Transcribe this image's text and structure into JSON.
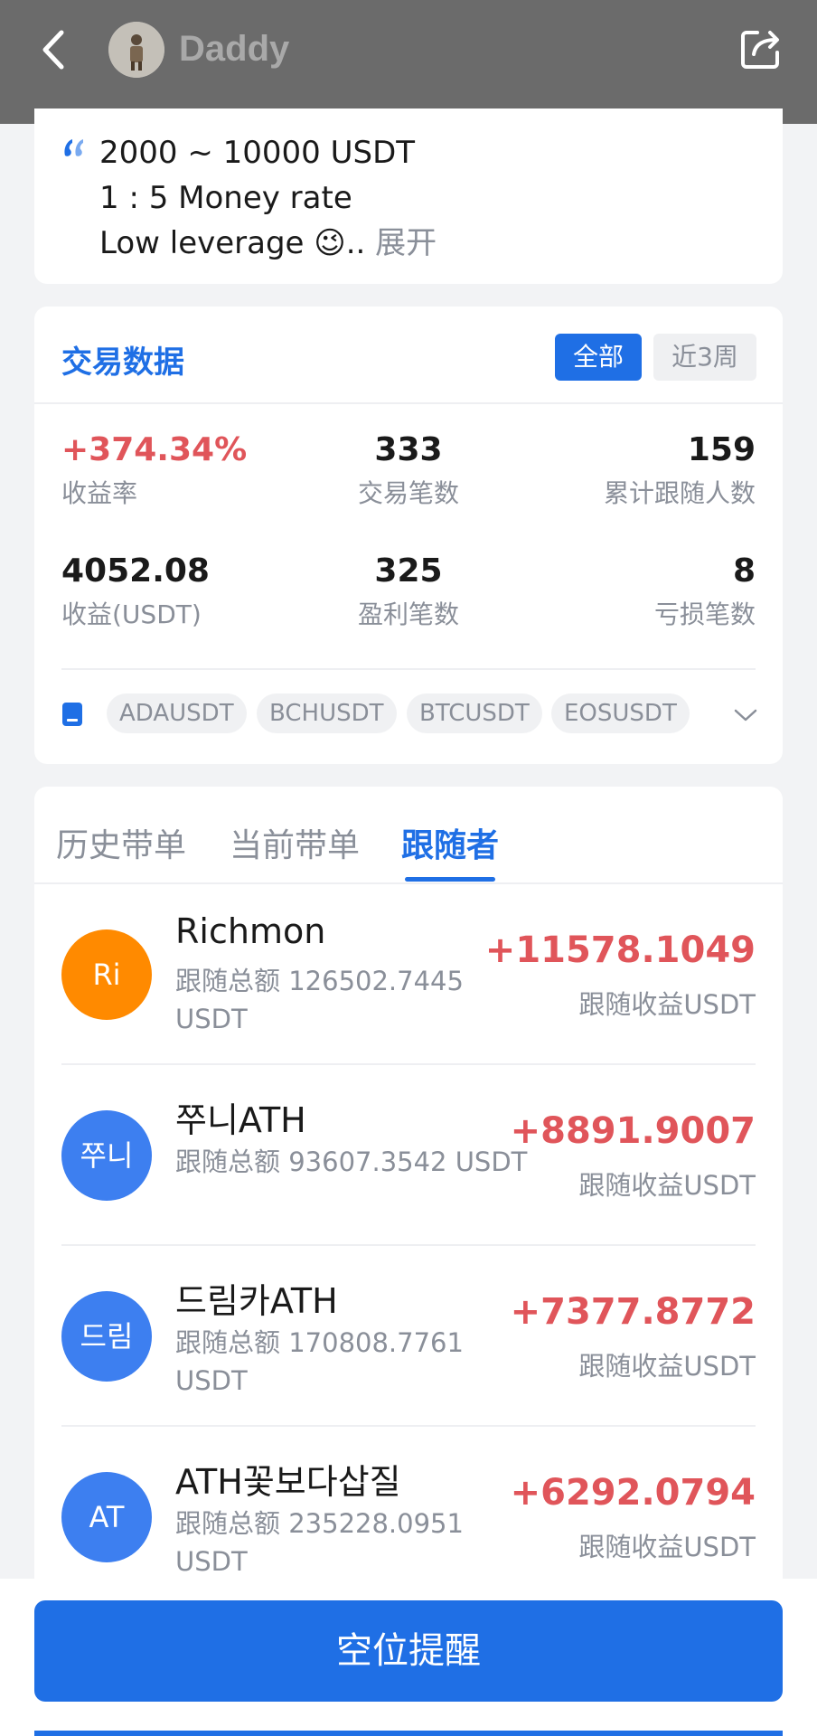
{
  "header": {
    "title": "Daddy"
  },
  "description": {
    "line1": "2000 ~ 10000 USDT",
    "line2": "1 : 5 Money rate",
    "line3": "Low leverage 😉..",
    "expand": "展开"
  },
  "trade": {
    "title": "交易数据",
    "tab_all": "全部",
    "tab_3w": "近3周",
    "stats": {
      "yield": {
        "value": "+374.34%",
        "label": "收益率"
      },
      "trades": {
        "value": "333",
        "label": "交易笔数"
      },
      "followers_total": {
        "value": "159",
        "label": "累计跟随人数"
      },
      "profit": {
        "value": "4052.08",
        "label": "收益(USDT)"
      },
      "win_trades": {
        "value": "325",
        "label": "盈利笔数"
      },
      "loss_trades": {
        "value": "8",
        "label": "亏损笔数"
      }
    },
    "pairs": [
      "ADAUSDT",
      "BCHUSDT",
      "BTCUSDT",
      "EOSUSDT"
    ]
  },
  "tabs": {
    "history": "历史带单",
    "current": "当前带单",
    "followers": "跟随者"
  },
  "followers": [
    {
      "avatar": "Ri",
      "avatar_color": "#ff8a00",
      "name": "Richmon",
      "amount": "跟随总额 126502.7445 USDT",
      "profit": "+11578.1049",
      "profit_label": "跟随收益USDT"
    },
    {
      "avatar": "쭈니",
      "avatar_color": "#3d7ff0",
      "name": "쭈니ATH",
      "amount": "跟随总额 93607.3542 USDT",
      "profit": "+8891.9007",
      "profit_label": "跟随收益USDT"
    },
    {
      "avatar": "드림",
      "avatar_color": "#3d7ff0",
      "name": "드림카ATH",
      "amount": "跟随总额 170808.7761 USDT",
      "profit": "+7377.8772",
      "profit_label": "跟随收益USDT"
    },
    {
      "avatar": "AT",
      "avatar_color": "#3d7ff0",
      "name": "ATH꽃보다삽질",
      "amount": "跟随总额 235228.0951 USDT",
      "profit": "+6292.0794",
      "profit_label": "跟随收益USDT"
    }
  ],
  "bottom": {
    "button": "空位提醒"
  }
}
